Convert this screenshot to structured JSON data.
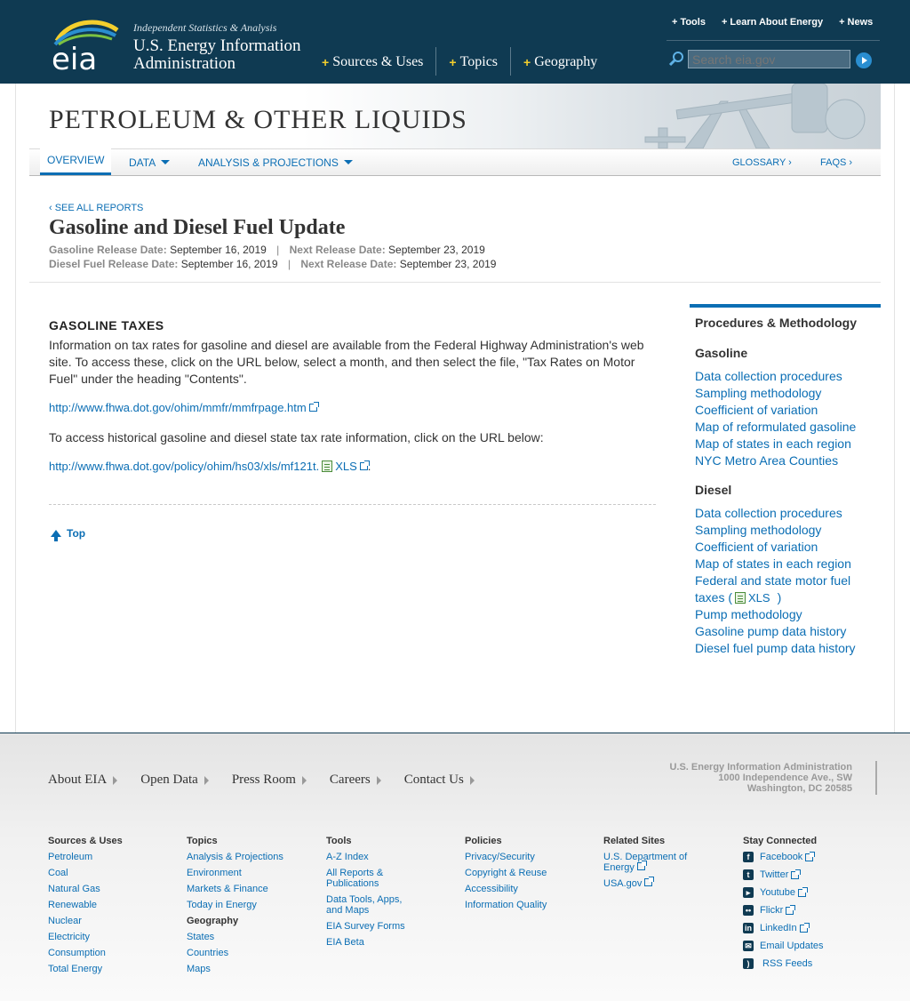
{
  "header": {
    "logo_text": "eia",
    "tagline": "Independent Statistics & Analysis",
    "agency_name": "U.S. Energy Information Administration",
    "main_nav": [
      "Sources & Uses",
      "Topics",
      "Geography"
    ],
    "top_links": [
      "Tools",
      "Learn About Energy",
      "News"
    ],
    "search_placeholder": "Search eia.gov"
  },
  "banner": {
    "title": "PETROLEUM & OTHER LIQUIDS"
  },
  "subnav": {
    "items": [
      "OVERVIEW",
      "DATA",
      "ANALYSIS & PROJECTIONS"
    ],
    "right": [
      "GLOSSARY ›",
      "FAQS ›"
    ]
  },
  "report": {
    "see_all": "‹ SEE ALL REPORTS",
    "title": "Gasoline and Diesel Fuel Update",
    "gas_release_label": "Gasoline Release Date:",
    "gas_release_date": "September 16, 2019",
    "gas_next_label": "Next Release Date:",
    "gas_next_date": "September 23, 2019",
    "diesel_release_label": "Diesel Fuel Release Date:",
    "diesel_release_date": "September 16, 2019",
    "diesel_next_label": "Next Release Date:",
    "diesel_next_date": "September 23, 2019",
    "pipe": "|"
  },
  "content": {
    "heading": "GASOLINE TAXES",
    "para1": "Information on tax rates for gasoline and diesel are available from the Federal Highway Administration's web site. To access these, click on the URL below, select a month, and then select the file, \"Tax Rates on Motor Fuel\" under the heading \"Contents\".",
    "url1": "http://www.fhwa.dot.gov/ohim/mmfr/mmfrpage.htm",
    "para2": "To access historical gasoline and diesel state tax rate information, click on the URL below:",
    "url2": "http://www.fhwa.dot.gov/policy/ohim/hs03/xls/mf121t.",
    "url2_xls": "XLS",
    "url2_end": ".",
    "top_label": "Top"
  },
  "sidebar": {
    "title": "Procedures & Methodology",
    "gasoline_heading": "Gasoline",
    "gasoline_links": [
      "Data collection procedures",
      "Sampling methodology",
      "Coefficient of variation",
      "Map of reformulated gasoline",
      "Map of states in each region",
      "NYC Metro Area Counties"
    ],
    "diesel_heading": "Diesel",
    "diesel_links": [
      "Data collection procedures",
      "Sampling methodology",
      "Coefficient of variation",
      "Map of states in each region",
      "Federal and state motor fuel",
      "taxes (",
      "XLS",
      ")",
      "Pump methodology",
      "Gasoline pump data history",
      "Diesel fuel pump data history"
    ]
  },
  "footer": {
    "nav": [
      "About EIA",
      "Open Data",
      "Press Room",
      "Careers",
      "Contact Us"
    ],
    "address": [
      "U.S. Energy Information Administration",
      "1000 Independence Ave., SW",
      "Washington, DC 20585"
    ],
    "columns": {
      "sources": {
        "title": "Sources & Uses",
        "links": [
          "Petroleum",
          "Coal",
          "Natural Gas",
          "Renewable",
          "Nuclear",
          "Electricity",
          "Consumption",
          "Total Energy"
        ]
      },
      "topics": {
        "title": "Topics",
        "links": [
          "Analysis & Projections",
          "Environment",
          "Markets & Finance",
          "Today in Energy"
        ],
        "sub_title": "Geography",
        "sub_links": [
          "States",
          "Countries",
          "Maps"
        ]
      },
      "tools": {
        "title": "Tools",
        "links": [
          "A-Z Index",
          "All Reports & Publications",
          "Data Tools, Apps, and Maps",
          "EIA Survey Forms",
          "EIA Beta"
        ]
      },
      "policies": {
        "title": "Policies",
        "links": [
          "Privacy/Security",
          "Copyright & Reuse",
          "Accessibility",
          "Information Quality"
        ]
      },
      "related": {
        "title": "Related Sites",
        "links": [
          "U.S. Department of Energy",
          "USA.gov"
        ]
      },
      "social": {
        "title": "Stay Connected",
        "links": [
          "Facebook",
          "Twitter",
          "Youtube",
          "Flickr",
          "LinkedIn",
          "Email Updates",
          "RSS Feeds"
        ]
      }
    }
  },
  "colors": {
    "header_bg": "#0f3a52",
    "link": "#0b6eb4",
    "accent_plus": "#f4cf2d"
  }
}
